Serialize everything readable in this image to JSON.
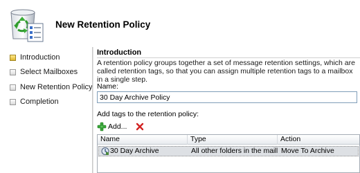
{
  "header": {
    "title": "New Retention Policy",
    "icon": "recycle-policy-icon"
  },
  "nav": {
    "items": [
      {
        "label": "Introduction",
        "active": true
      },
      {
        "label": "Select Mailboxes",
        "active": false
      },
      {
        "label": "New Retention Policy",
        "active": false
      },
      {
        "label": "Completion",
        "active": false
      }
    ]
  },
  "main": {
    "section_title": "Introduction",
    "description": "A retention policy groups together a set of message retention settings, which are called retention tags, so that you can assign multiple retention tags to a mailbox in a single step.",
    "name_label": "Name:",
    "name_value": "30 Day Archive Policy",
    "tags_label": "Add tags to the retention policy:",
    "toolbar": {
      "add_label": "Add...",
      "remove_icon": "red-x-delete-icon"
    },
    "table": {
      "columns": [
        "Name",
        "Type",
        "Action"
      ],
      "rows": [
        {
          "name": "30 Day Archive",
          "type": "All other folders in the mailb...",
          "action": "Move To Archive",
          "selected": true
        }
      ]
    }
  },
  "colors": {
    "active_step": "#e8c040",
    "selected_row": "#dde0e4",
    "input_border": "#7f9db9"
  }
}
